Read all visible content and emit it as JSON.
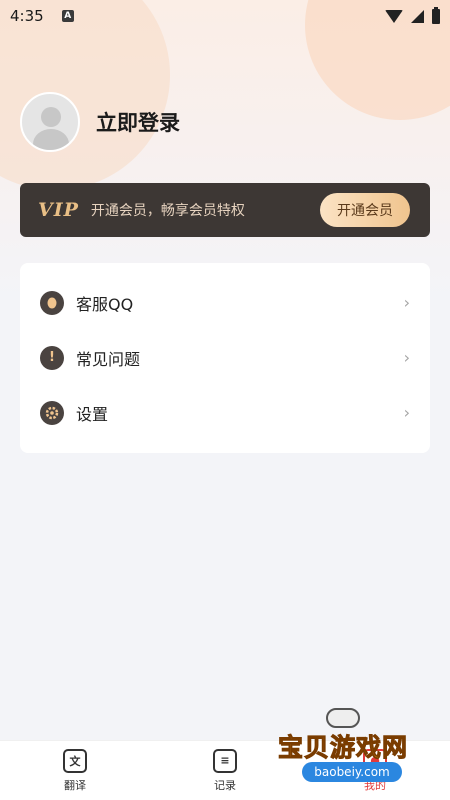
{
  "status_bar": {
    "time": "4:35",
    "notification_badge": "A"
  },
  "profile": {
    "login_label": "立即登录"
  },
  "vip": {
    "logo": "VIP",
    "promo_text": "开通会员，畅享会员特权",
    "button_label": "开通会员"
  },
  "menu": {
    "items": [
      {
        "label": "客服QQ",
        "icon": "qq-icon"
      },
      {
        "label": "常见问题",
        "icon": "question-icon"
      },
      {
        "label": "设置",
        "icon": "settings-gear-icon"
      }
    ]
  },
  "bottom_nav": {
    "items": [
      {
        "label": "翻译",
        "icon": "translate-icon"
      },
      {
        "label": "记录",
        "icon": "record-icon"
      },
      {
        "label": "我的",
        "icon": "profile-icon"
      }
    ],
    "active": "我的"
  },
  "watermark": {
    "title": "宝贝游戏网",
    "site": "baobeiy.com"
  },
  "colors": {
    "vip_bg": "#3d3734",
    "vip_gold": "#f0c48e",
    "active_tab": "#e23a3a"
  }
}
